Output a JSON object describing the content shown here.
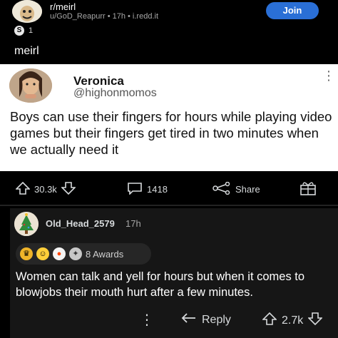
{
  "post": {
    "subreddit": "r/meirl",
    "author_meta": "u/GoD_Reapurr • 17h • i.redd.it",
    "join_label": "Join",
    "award_count": "1",
    "award_coin": "S",
    "title": "meirl"
  },
  "tweet": {
    "name": "Veronica",
    "handle": "@highonmomos",
    "text": "Boys can use their fingers for hours while playing video games but their fingers get tired in two minutes when we actually need it"
  },
  "post_actions": {
    "upvotes": "30.3k",
    "comments": "1418",
    "share_label": "Share"
  },
  "comment": {
    "username": "Old_Head_2579",
    "time": "17h",
    "awards_label": "8 Awards",
    "text": "Women can talk and yell for hours but when it comes to blowjobs their mouth hurt after a few minutes.",
    "reply_label": "Reply",
    "votes": "2.7k"
  },
  "colors": {
    "accent": "#2a6fd6",
    "background": "#000000",
    "comment_bg": "#161616"
  }
}
